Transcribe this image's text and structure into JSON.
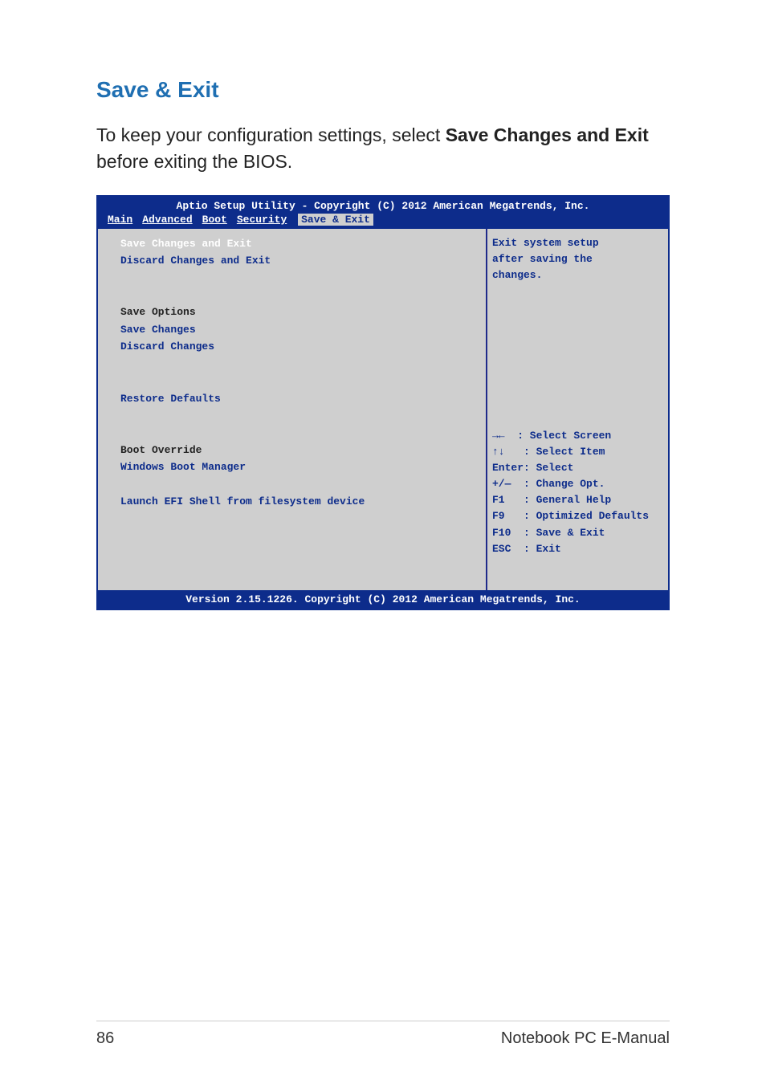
{
  "heading": "Save & Exit",
  "intro_pre": "To keep your configuration settings, select ",
  "intro_bold": "Save Changes and Exit",
  "intro_post": " before exiting the BIOS.",
  "bios": {
    "top_title": "Aptio Setup Utility - Copyright (C) 2012 American Megatrends, Inc.",
    "tabs": {
      "main": "Main",
      "advanced": "Advanced",
      "boot": "Boot",
      "security": "Security",
      "save_exit": "Save & Exit"
    },
    "left": {
      "save_changes_exit": "Save Changes and Exit",
      "discard_changes_exit": "Discard Changes and Exit",
      "save_options": "Save Options",
      "save_changes": "Save Changes",
      "discard_changes": "Discard Changes",
      "restore_defaults": "Restore Defaults",
      "boot_override": "Boot Override",
      "windows_boot_manager": "Windows Boot Manager",
      "launch_efi": "Launch EFI Shell from filesystem device"
    },
    "right": {
      "help_line1": "Exit system setup",
      "help_line2": "after saving the",
      "help_line3": "changes.",
      "k_select_screen": "→←  : Select Screen",
      "k_select_item": "↑↓   : Select Item",
      "k_enter": "Enter: Select",
      "k_change": "+/—  : Change Opt.",
      "k_f1": "F1   : General Help",
      "k_f9": "F9   : Optimized Defaults",
      "k_f10": "F10  : Save & Exit",
      "k_esc": "ESC  : Exit"
    },
    "bottom": "Version 2.15.1226. Copyright (C) 2012 American Megatrends, Inc."
  },
  "footer": {
    "page_num": "86",
    "doc_title": "Notebook PC E-Manual"
  }
}
